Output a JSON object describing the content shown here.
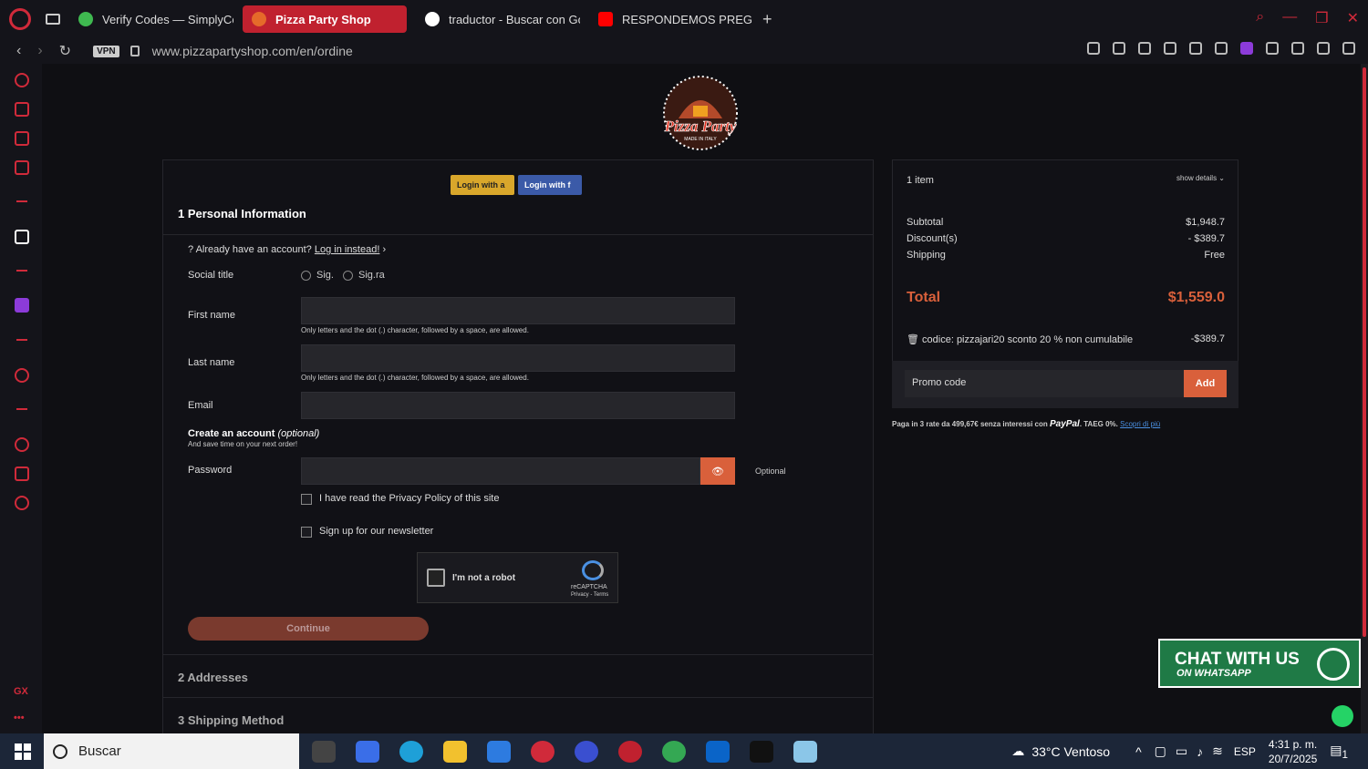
{
  "browser": {
    "tabs": [
      {
        "label": "Verify Codes — SimplyCo",
        "active": false,
        "favicon_color": "#3fb950"
      },
      {
        "label": "Pizza Party Shop",
        "active": true,
        "favicon_color": "#e56a2a"
      },
      {
        "label": "traductor - Buscar con Go",
        "active": false,
        "favicon_color": "#ffffff"
      },
      {
        "label": "RESPONDEMOS PREGUN",
        "active": false,
        "favicon_color": "#ff0000"
      }
    ],
    "vpn_label": "VPN",
    "url": "www.pizzapartyshop.com/en/ordine",
    "accent": "#d02a3a"
  },
  "sidebar": {
    "gx_label": "GX",
    "more": "•••"
  },
  "logo": {
    "line1": "Pizza Party",
    "line2": "MADE IN ITALY"
  },
  "login": {
    "amazon": "Login with a",
    "facebook": "Login with f"
  },
  "form": {
    "step1": "1 Personal Information",
    "already_text": "Already have an account?",
    "login_link": "Log in instead!",
    "social_title_label": "Social title",
    "title_options": [
      "Sig.",
      "Sig.ra"
    ],
    "first_name_label": "First name",
    "last_name_label": "Last name",
    "name_hint": "Only letters and the dot (.) character, followed by a space, are allowed.",
    "email_label": "Email",
    "create_account": "Create an account",
    "optional_paren": "(optional)",
    "create_sub": "And save time on your next order!",
    "password_label": "Password",
    "optional": "Optional",
    "privacy_label": "I have read the Privacy Policy of this site",
    "newsletter_label": "Sign up for our newsletter",
    "recaptcha_text": "I'm not a robot",
    "recaptcha_brand": "reCAPTCHA",
    "recaptcha_terms": "Privacy - Terms",
    "continue": "Continue",
    "step2": "2 Addresses",
    "step3": "3 Shipping Method"
  },
  "summary": {
    "items": "1 item",
    "show_details": "show details ⌄",
    "subtotal_label": "Subtotal",
    "subtotal": "$1,948.7",
    "discount_label": "Discount(s)",
    "discount": "- $389.7",
    "shipping_label": "Shipping",
    "shipping": "Free",
    "total_label": "Total",
    "total": "$1,559.0",
    "code_label": "codice: pizzajari20 sconto 20 % non cumulabile",
    "code_value": "-$389.7",
    "promo_placeholder": "Promo code",
    "promo_add": "Add",
    "paypal_text": "Paga in 3 rate da 499,67€ senza interessi con",
    "paypal_brand": "PayPal",
    "paypal_taeg": ". TAEG 0%.",
    "paypal_link": "Scopri di più"
  },
  "whatsapp": {
    "title": "CHAT WITH US",
    "subtitle": "ON WHATSAPP"
  },
  "taskbar": {
    "search": "Buscar",
    "weather": "33°C Ventoso",
    "lang": "ESP",
    "time": "4:31 p. m.",
    "date": "20/7/2025",
    "notifications": "1"
  }
}
